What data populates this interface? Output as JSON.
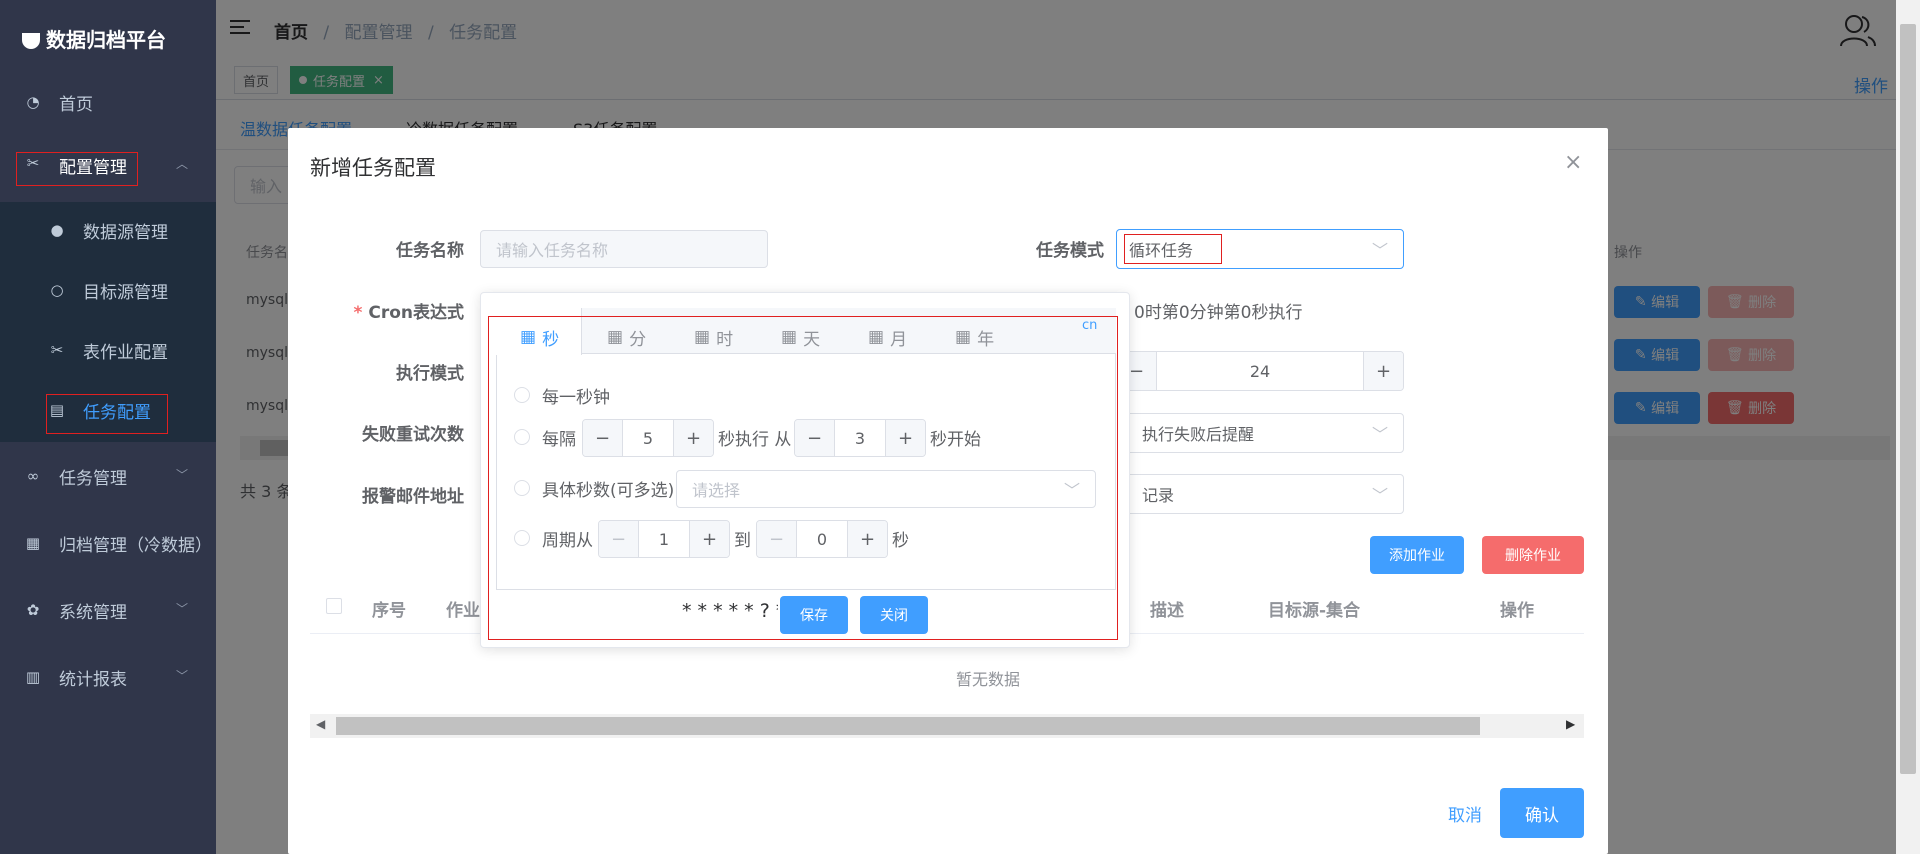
{
  "sidebar": {
    "logo": "数据归档平台",
    "items": [
      {
        "label": "首页",
        "icon": "dashboard-icon"
      },
      {
        "label": "配置管理",
        "icon": "tools-icon"
      },
      {
        "label": "数据源管理",
        "icon": "user-icon"
      },
      {
        "label": "目标源管理",
        "icon": "bulb-icon"
      },
      {
        "label": "表作业配置",
        "icon": "tools-icon"
      },
      {
        "label": "任务配置",
        "icon": "doc-icon"
      },
      {
        "label": "任务管理",
        "icon": "link-icon"
      },
      {
        "label": "归档管理（冷数据）",
        "icon": "archive-icon"
      },
      {
        "label": "系统管理",
        "icon": "gear-icon"
      },
      {
        "label": "统计报表",
        "icon": "report-icon"
      }
    ]
  },
  "header": {
    "breadcrumb": [
      "首页",
      "配置管理",
      "任务配置"
    ],
    "sep": "/",
    "tags": [
      "首页",
      "任务配置"
    ],
    "tag_close": "×",
    "op_label": "操作"
  },
  "background": {
    "tabs": [
      "温数据任务配置",
      "冷数据任务配置",
      "S3任务配置"
    ],
    "search_placeholder": "输入",
    "col_task": "任务名",
    "col_op": "操作",
    "rows": [
      "mysql-",
      "mysql-",
      "mysql-"
    ],
    "edit": "编辑",
    "delete": "删除",
    "total": "共 3 条"
  },
  "dialog": {
    "title": "新增任务配置",
    "close": "×",
    "task_name_label": "任务名称",
    "task_name_placeholder": "请输入任务名称",
    "task_mode_label": "任务模式",
    "task_mode_value": "循环任务",
    "cron_label": "Cron表达式",
    "cron_required": "*",
    "cron_desc": "0时第0分钟第0秒执行",
    "exec_mode_label": "执行模式",
    "exec_num_value": "24",
    "retry_label": "失败重试次数",
    "retry_select": "执行失败后提醒",
    "email_label": "报警邮件地址",
    "email_select": "记录",
    "add_job": "添加作业",
    "delete_job": "删除作业",
    "table_headers": [
      "序号",
      "作业",
      "描述",
      "目标源-集合",
      "操作"
    ],
    "empty_text": "暂无数据",
    "cancel": "取消",
    "confirm": "确认"
  },
  "cron": {
    "tabs": [
      "秒",
      "分",
      "时",
      "天",
      "月",
      "年"
    ],
    "lang": "cn",
    "opt1": "每一秒钟",
    "opt2_prefix": "每隔",
    "opt2_val1": "5",
    "opt2_mid": "秒执行 从",
    "opt2_val2": "3",
    "opt2_suffix": "秒开始",
    "opt3_label": "具体秒数(可多选)",
    "opt3_placeholder": "请选择",
    "opt4_prefix": "周期从",
    "opt4_val1": "1",
    "opt4_mid": "到",
    "opt4_val2": "0",
    "opt4_suffix": "秒",
    "expression": "* * * * * ? *",
    "save": "保存",
    "close": "关闭"
  },
  "colors": {
    "primary": "#409eff",
    "danger": "#f56c6c",
    "success": "#42b983",
    "sidebar_bg": "#30364a"
  }
}
